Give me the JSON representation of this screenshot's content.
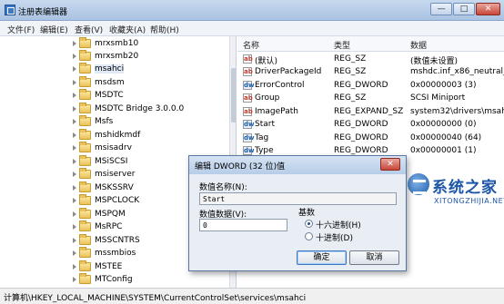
{
  "window": {
    "title": "注册表编辑器",
    "buttons": {
      "minimize": "—",
      "maximize": "□",
      "close": "✕"
    }
  },
  "menu": [
    "文件(F)",
    "编辑(E)",
    "查看(V)",
    "收藏夹(A)",
    "帮助(H)"
  ],
  "tree": {
    "items": [
      "mrxsmb10",
      "mrxsmb20",
      "msahci",
      "msdsm",
      "MSDTC",
      "MSDTC Bridge 3.0.0.0",
      "Msfs",
      "mshidkmdf",
      "msisadrv",
      "MSiSCSI",
      "msiserver",
      "MSKSSRV",
      "MSPCLOCK",
      "MSPQM",
      "MsRPC",
      "MSSCNTRS",
      "mssmbios",
      "MSTEE",
      "MTConfig"
    ],
    "selected": "msahci"
  },
  "list": {
    "headers": {
      "name": "名称",
      "type": "类型",
      "data": "数据"
    },
    "rows": [
      {
        "icon": "ab",
        "name": "(默认)",
        "type": "REG_SZ",
        "data": "(数值未设置)"
      },
      {
        "icon": "ab",
        "name": "DriverPackageId",
        "type": "REG_SZ",
        "data": "mshdc.inf_x86_neutral_fe"
      },
      {
        "icon": "dw",
        "name": "ErrorControl",
        "type": "REG_DWORD",
        "data": "0x00000003 (3)"
      },
      {
        "icon": "ab",
        "name": "Group",
        "type": "REG_SZ",
        "data": "SCSI Miniport"
      },
      {
        "icon": "ab",
        "name": "ImagePath",
        "type": "REG_EXPAND_SZ",
        "data": "system32\\drivers\\msahc"
      },
      {
        "icon": "dw",
        "name": "Start",
        "type": "REG_DWORD",
        "data": "0x00000000 (0)"
      },
      {
        "icon": "dw",
        "name": "Tag",
        "type": "REG_DWORD",
        "data": "0x00000040 (64)"
      },
      {
        "icon": "dw",
        "name": "Type",
        "type": "REG_DWORD",
        "data": "0x00000001 (1)"
      }
    ]
  },
  "dialog": {
    "title": "编辑 DWORD (32 位)值",
    "close": "✕",
    "value_name_label": "数值名称(N):",
    "value_name": "Start",
    "value_data_label": "数值数据(V):",
    "value_data": "0",
    "base_label": "基数",
    "hex_label": "十六进制(H)",
    "dec_label": "十进制(D)",
    "base_selected": "hex",
    "ok": "确定",
    "cancel": "取消"
  },
  "watermark": {
    "name": "系统之家",
    "sub": "XITONGZHIJIA.NET"
  },
  "status": "计算机\\HKEY_LOCAL_MACHINE\\SYSTEM\\CurrentControlSet\\services\\msahci",
  "colors": {
    "accent": "#1c56a6",
    "selection": "#dfe9f7",
    "titlebar": "#aac3e2"
  }
}
